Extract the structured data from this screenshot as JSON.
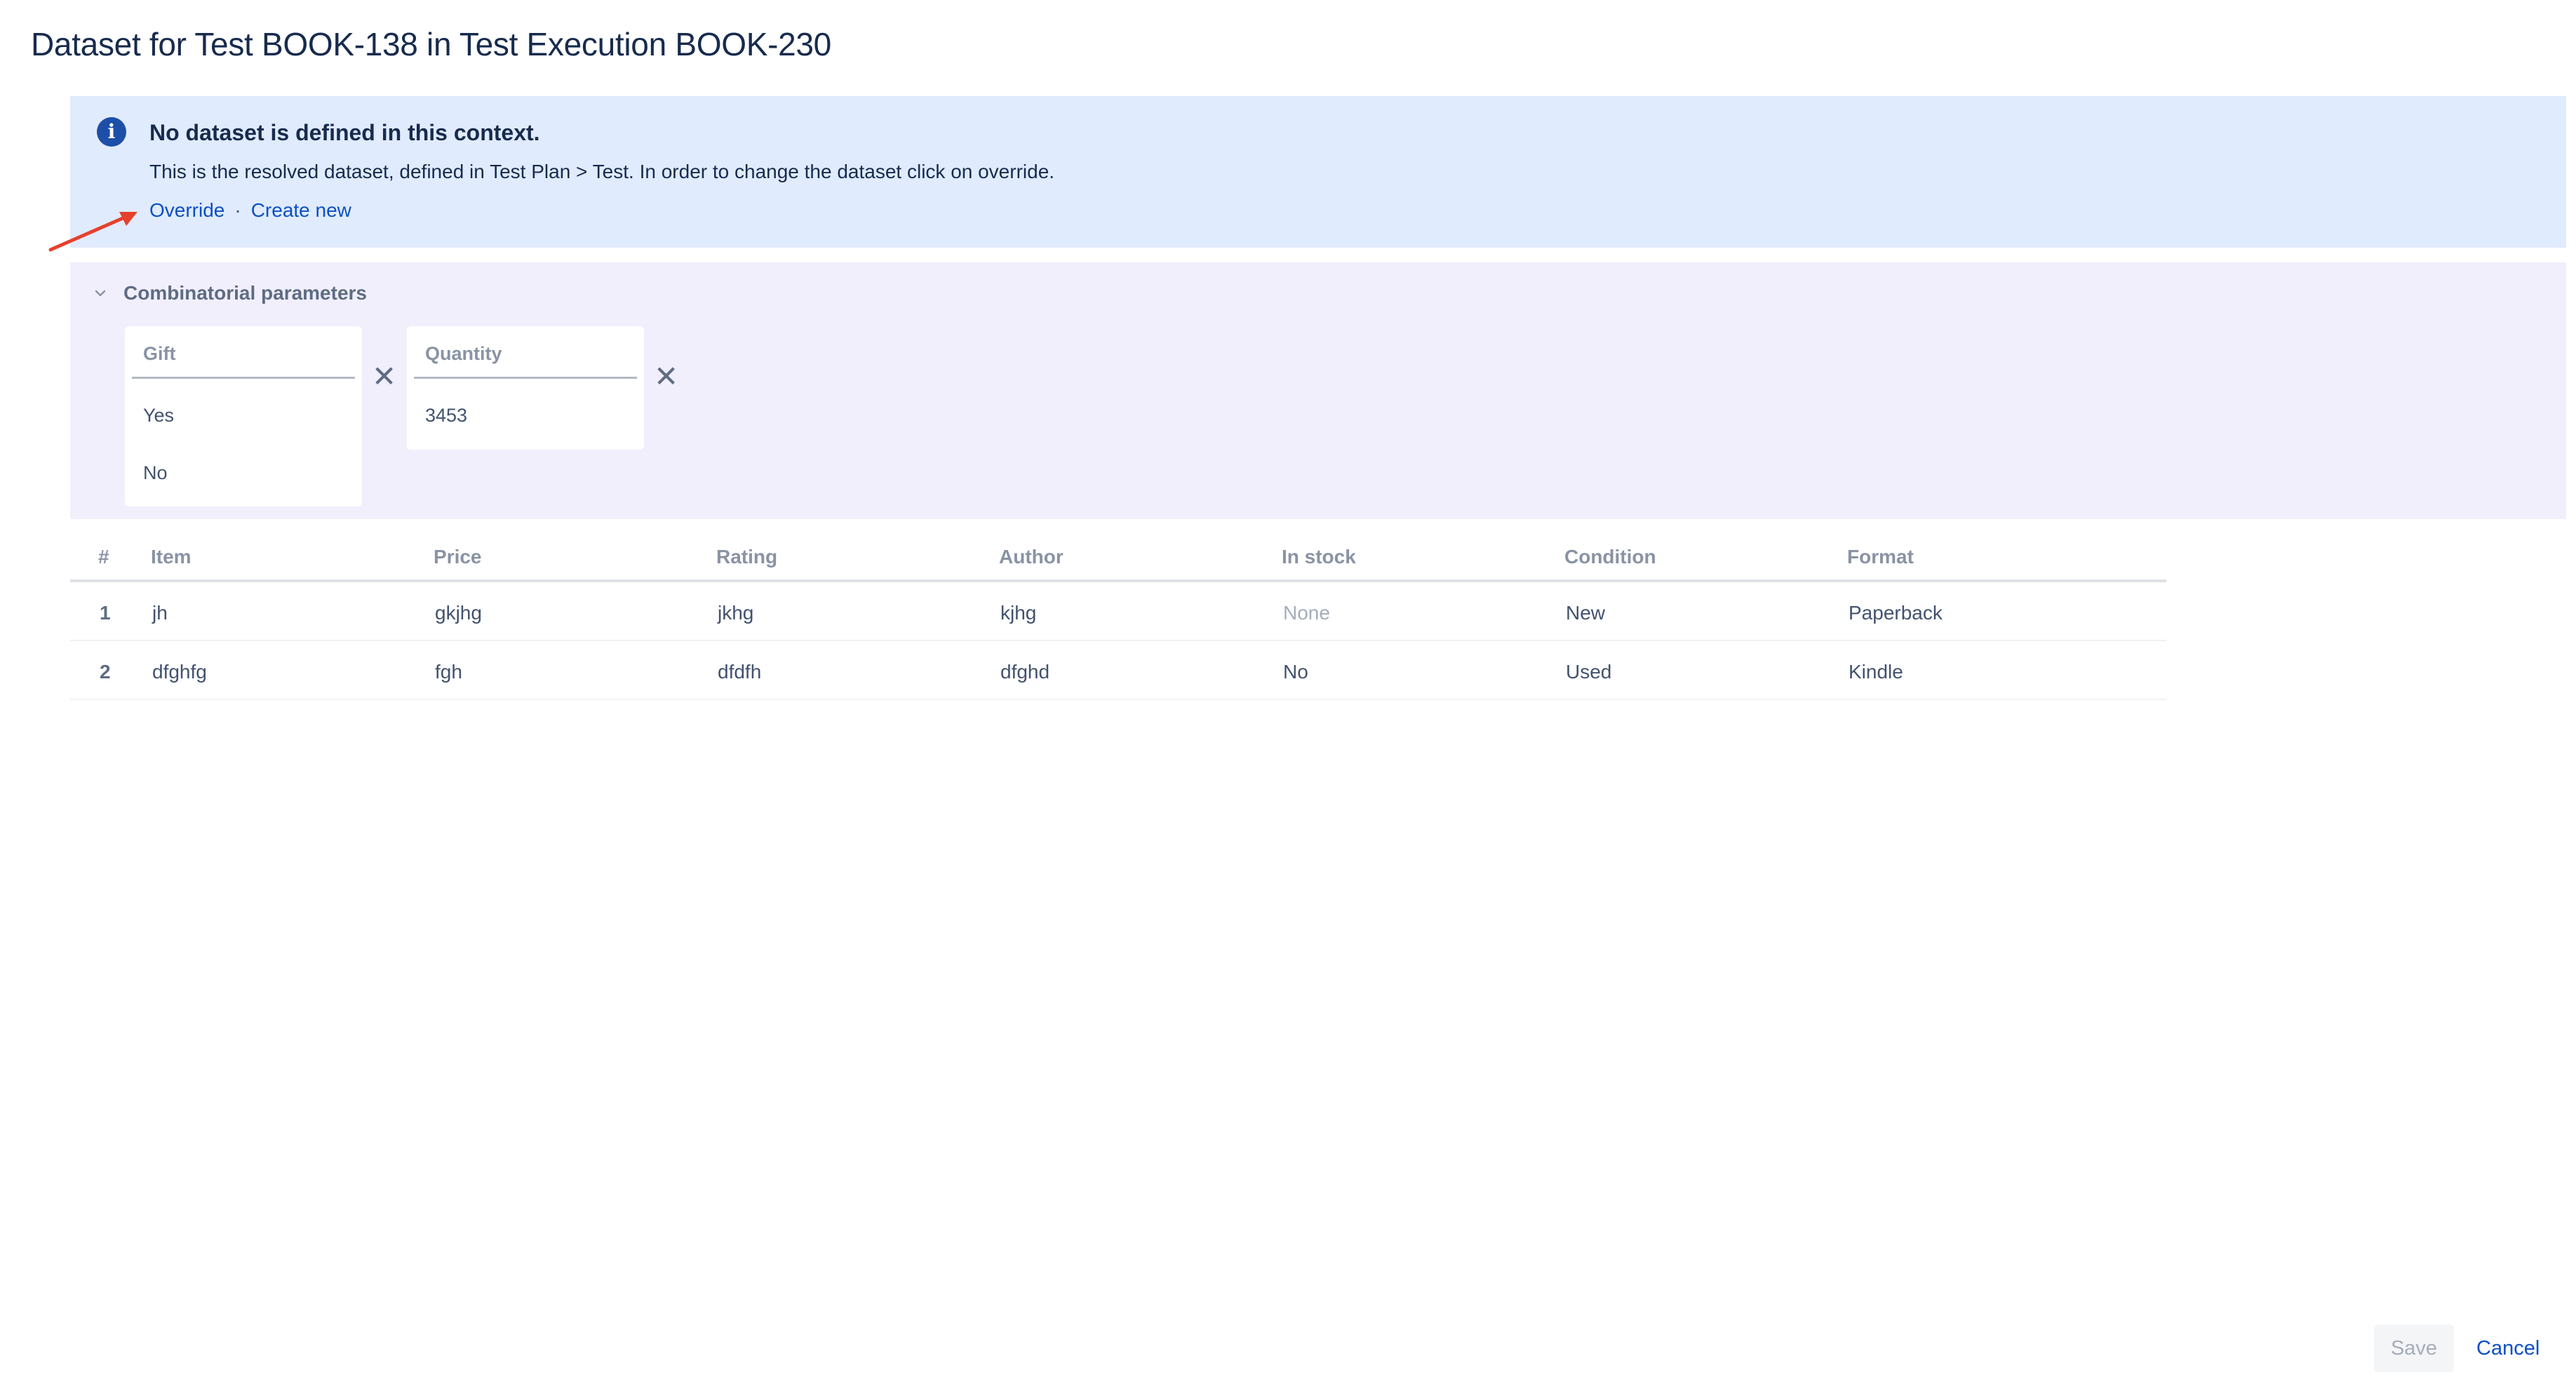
{
  "page": {
    "title": "Dataset for Test BOOK-138 in Test Execution BOOK-230"
  },
  "info": {
    "icon": "info-icon",
    "icon_glyph": "i",
    "heading": "No dataset is defined in this context.",
    "body": "This is the resolved dataset, defined in Test Plan > Test. In order to change the dataset click on override.",
    "link_override": "Override",
    "separator": "·",
    "link_create": "Create new",
    "accent_color": "#e0ebfd"
  },
  "combinatorial": {
    "label": "Combinatorial parameters",
    "remove_glyph": "✕",
    "params": [
      {
        "name": "Gift",
        "values": [
          "Yes",
          "No"
        ]
      },
      {
        "name": "Quantity",
        "values": [
          "3453"
        ]
      }
    ]
  },
  "table": {
    "columns": [
      "#",
      "Item",
      "Price",
      "Rating",
      "Author",
      "In stock",
      "Condition",
      "Format"
    ],
    "rows": [
      [
        "1",
        "jh",
        "gkjhg",
        "jkhg",
        "kjhg",
        "None",
        "New",
        "Paperback"
      ],
      [
        "2",
        "dfghfg",
        "fgh",
        "dfdfh",
        "dfghd",
        "No",
        "Used",
        "Kindle"
      ]
    ]
  },
  "footer": {
    "save_label": "Save",
    "cancel_label": "Cancel"
  },
  "colors": {
    "link": "#0c4fc4",
    "annotation_arrow": "#e5412d"
  }
}
